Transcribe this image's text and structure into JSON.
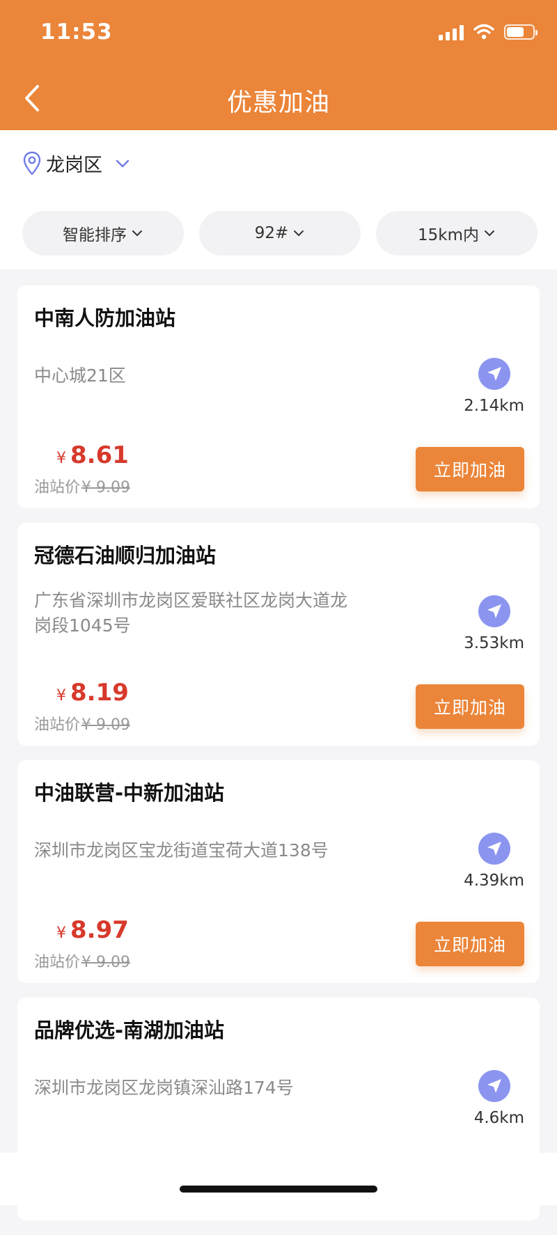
{
  "status_bar": {
    "time": "11:53"
  },
  "nav": {
    "title": "优惠加油"
  },
  "location": {
    "district": "龙岗区"
  },
  "filters": [
    {
      "label": "智能排序"
    },
    {
      "label": "92#"
    },
    {
      "label": "15km内"
    }
  ],
  "stations": [
    {
      "name": "中南人防加油站",
      "address": "中心城21区",
      "distance": "2.14km",
      "price_symbol": "¥",
      "price": "8.61",
      "station_price_label": "油站价",
      "station_price": "¥ 9.09",
      "button": "立即加油"
    },
    {
      "name": "冠德石油顺归加油站",
      "address": "广东省深圳市龙岗区爱联社区龙岗大道龙岗段1045号",
      "distance": "3.53km",
      "price_symbol": "¥",
      "price": "8.19",
      "station_price_label": "油站价",
      "station_price": "¥ 9.09",
      "button": "立即加油"
    },
    {
      "name": "中油联营-中新加油站",
      "address": "深圳市龙岗区宝龙街道宝荷大道138号",
      "distance": "4.39km",
      "price_symbol": "¥",
      "price": "8.97",
      "station_price_label": "油站价",
      "station_price": "¥ 9.09",
      "button": "立即加油"
    },
    {
      "name": "品牌优选-南湖加油站",
      "address": "深圳市龙岗区龙岗镇深汕路174号",
      "distance": "4.6km"
    }
  ],
  "colors": {
    "accent": "#eb8539",
    "price": "#d7392b",
    "nav_icon": "#8b95f0"
  }
}
